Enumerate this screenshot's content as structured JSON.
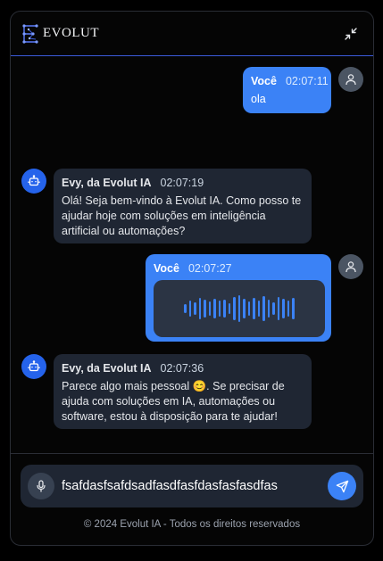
{
  "header": {
    "logo_text": "EVOLUT",
    "accent": "#3b5bdb",
    "minimize_icon": "minimize-arrows-icon"
  },
  "messages": [
    {
      "role": "user",
      "sender": "Você",
      "time": "02:07:11",
      "text": "ola",
      "avatar_icon": "user-icon"
    },
    {
      "role": "bot",
      "sender": "Evy, da Evolut IA",
      "time": "02:07:19",
      "text": "Olá! Seja bem-vindo à Evolut IA. Como posso te ajudar hoje com soluções em inteligência artificial ou automações?",
      "avatar_icon": "bot-icon"
    },
    {
      "role": "user",
      "sender": "Você",
      "time": "02:07:27",
      "type": "audio",
      "avatar_icon": "user-icon"
    },
    {
      "role": "bot",
      "sender": "Evy, da Evolut IA",
      "time": "02:07:36",
      "text": "Parece algo mais pessoal 😊. Se precisar de ajuda com soluções em IA, automações ou software, estou à disposição para te ajudar!",
      "avatar_icon": "bot-icon"
    }
  ],
  "composer": {
    "value": "fsafdasfsafdsadfasdfasfdasfasfasdfas",
    "mic_icon": "microphone-icon",
    "send_icon": "send-icon"
  },
  "footer": {
    "text": "© 2024 Evolut IA - Todos os direitos reservados"
  },
  "colors": {
    "user_bubble": "#3b82f6",
    "bot_bubble": "#1f2633",
    "bot_avatar": "#2563eb"
  }
}
